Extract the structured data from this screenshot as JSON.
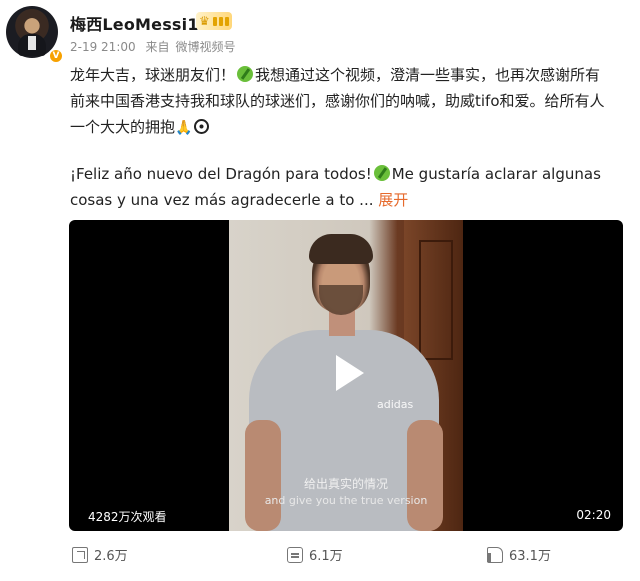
{
  "post": {
    "author": "梅西LeoMessi10",
    "verified_badge": "V",
    "time": "2-19 21:00",
    "source_prefix": "来自",
    "source_name": "微博视频号",
    "lines": [
      "龙年大吉，球迷朋友们！",
      "我想通过这个视频，澄清一些事实，也再次感谢所有",
      "前来中国香港支持我和球队的球迷们，感谢你们的呐喊，助威tifo和爱。给所有人",
      "一个大大的拥抱",
      "¡Feliz año nuevo del Dragón para todos!",
      "Me gustaría aclarar algunas",
      "cosas y una vez más agradecerle a to  ..."
    ],
    "expand_label": "展开"
  },
  "video": {
    "subtitle_cn": "给出真实的情况",
    "subtitle_en": "and give you the true version",
    "views": "4282万次观看",
    "duration": "02:20",
    "shirt_logo": "adidas"
  },
  "actions": {
    "share_count": "2.6万",
    "comment_count": "6.1万",
    "like_count": "63.1万"
  },
  "icons": {
    "share": "share-icon",
    "comment": "comment-icon",
    "like": "thumbs-up-icon",
    "play": "play-icon",
    "crown": "crown-badge-icon"
  },
  "colors": {
    "expand": "#e66a2c",
    "verified": "#f7a100",
    "meta": "#8a8a8a"
  }
}
